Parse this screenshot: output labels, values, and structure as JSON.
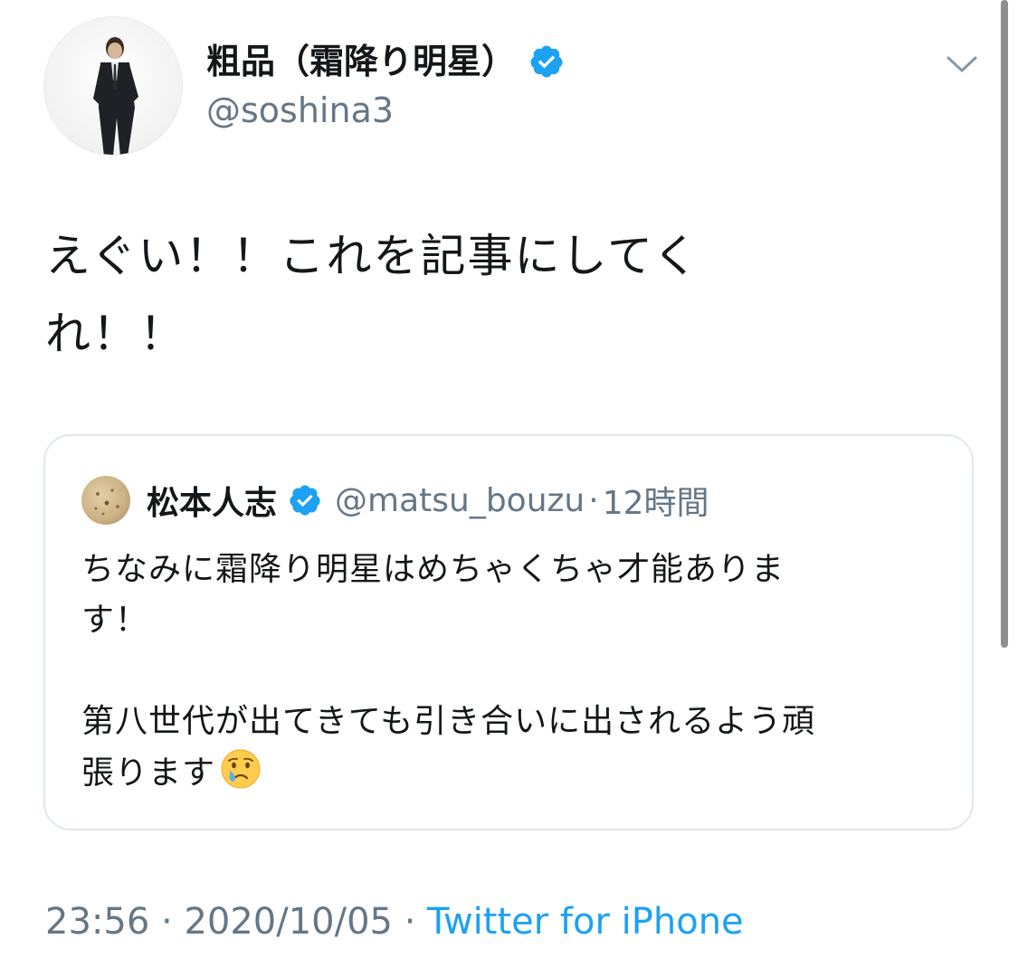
{
  "author": {
    "display_name": "粗品（霜降り明星）",
    "handle": "@soshina3",
    "verified": true,
    "avatar_icon": "profile-photo-man-in-suit"
  },
  "tweet": {
    "text_line1": "えぐい！！これを記事にしてく",
    "text_line2": "れ！！"
  },
  "quoted_tweet": {
    "display_name": "松本人志",
    "handle": "@matsu_bouzu",
    "separator": "·",
    "time": "12時間",
    "verified": true,
    "avatar_icon": "bread-texture-avatar",
    "text_para1_line1": "ちなみに霜降り明星はめちゃくちゃ才能ありま",
    "text_para1_line2": "す！",
    "text_para2_line1": "第八世代が出てきても引き合いに出されるよう頑",
    "text_para2_line2": "張ります",
    "emoji": "crying-face"
  },
  "footer": {
    "time": "23:56",
    "sep1": "·",
    "date": "2020/10/05",
    "sep2": "·",
    "source": "Twitter for iPhone"
  },
  "colors": {
    "verified_blue": "#1da1f2",
    "secondary_text": "#657786",
    "link_blue": "#1da1f2",
    "border": "#e1e8ed"
  },
  "icons": {
    "menu": "chevron-down-icon",
    "verified": "verified-badge-icon"
  }
}
